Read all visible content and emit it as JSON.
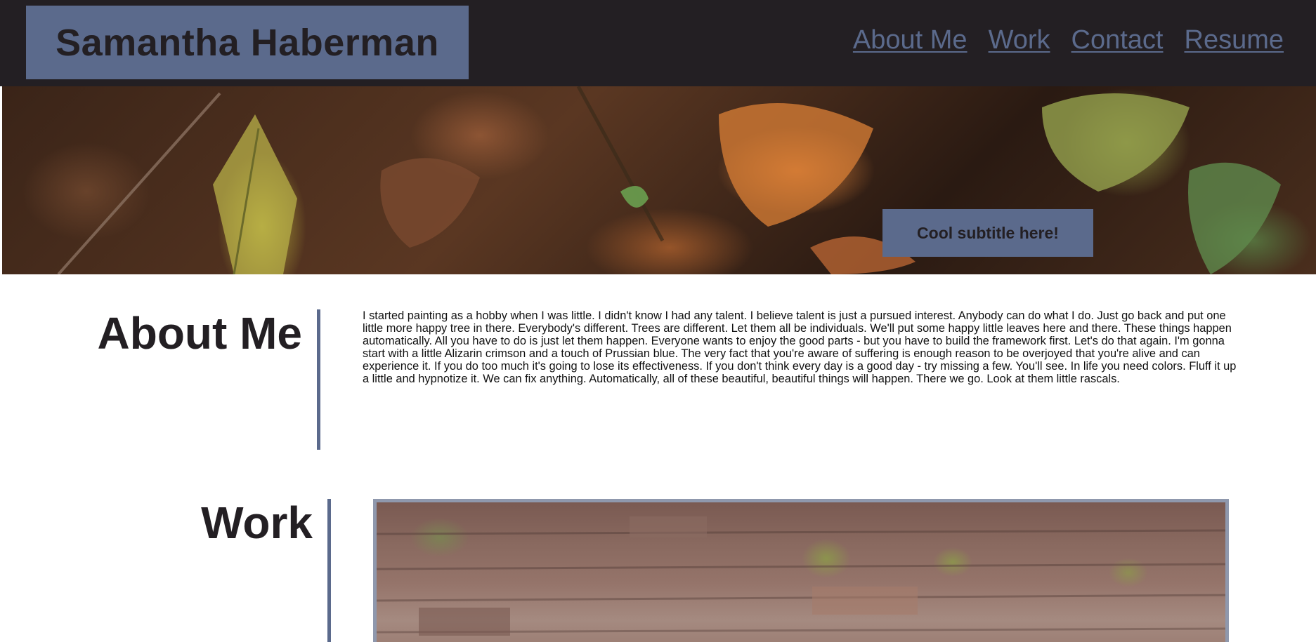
{
  "header": {
    "brand_name": "Samantha Haberman",
    "nav": [
      {
        "label": "About Me"
      },
      {
        "label": "Work"
      },
      {
        "label": "Contact"
      },
      {
        "label": "Resume"
      }
    ],
    "brand_color": "#5b6a8c",
    "background_color": "#231f23"
  },
  "hero": {
    "subtitle": "Cool subtitle here!"
  },
  "about": {
    "title": "About Me",
    "body": "I started painting as a hobby when I was little. I didn't know I had any talent. I believe talent is just a pursued interest. Anybody can do what I do. Just go back and put one little more happy tree in there. Everybody's different. Trees are different. Let them all be individuals. We'll put some happy little leaves here and there. These things happen automatically. All you have to do is just let them happen. Everyone wants to enjoy the good parts - but you have to build the framework first. Let's do that again. I'm gonna start with a little Alizarin crimson and a touch of Prussian blue. The very fact that you're aware of suffering is enough reason to be overjoyed that you're alive and can experience it. If you do too much it's going to lose its effectiveness. If you don't think every day is a good day - try missing a few. You'll see. In life you need colors. Fluff it up a little and hypnotize it. We can fix anything. Automatically, all of these beautiful, beautiful things will happen. There we go. Look at them little rascals."
  },
  "work": {
    "title": "Work"
  }
}
